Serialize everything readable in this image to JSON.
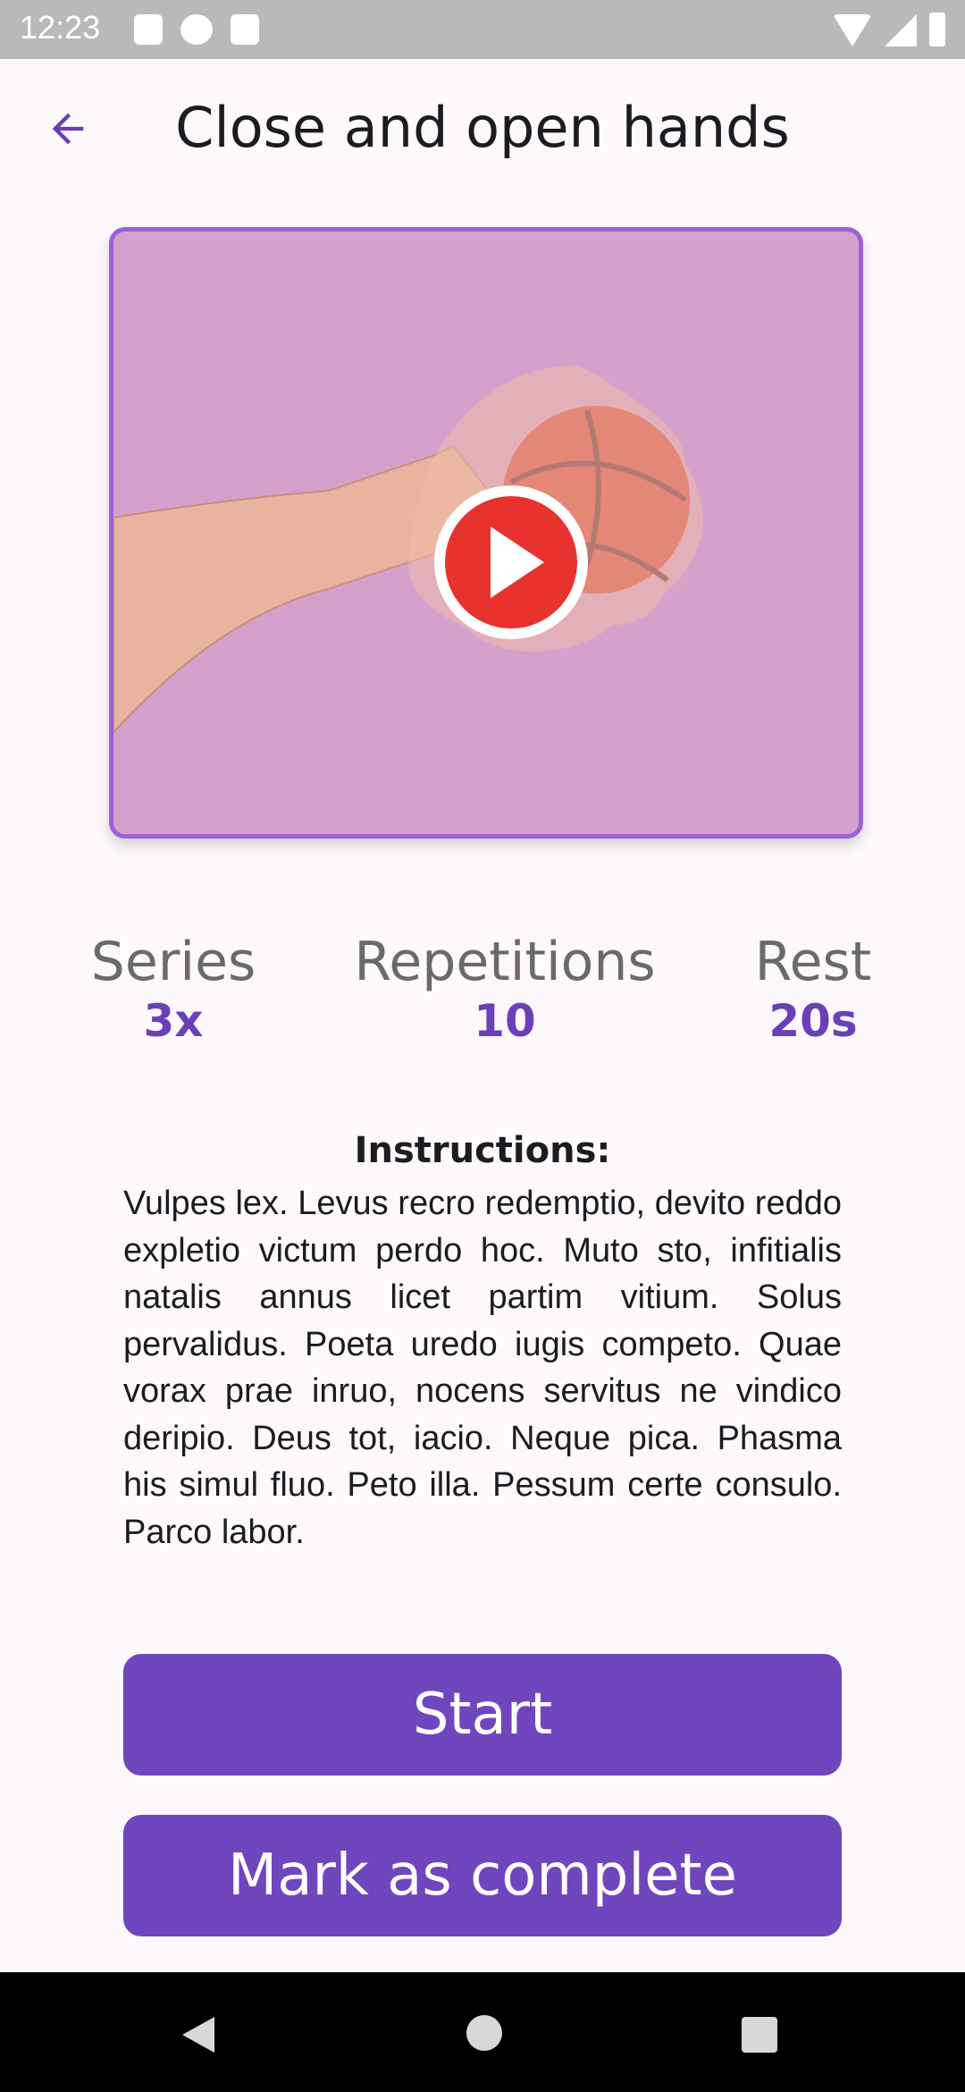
{
  "status_bar": {
    "time": "12:23"
  },
  "app_bar": {
    "title": "Close and open hands",
    "back_icon": "arrow-left-icon"
  },
  "video": {
    "play_icon": "play-icon",
    "accent": "#ea3a35"
  },
  "stats": {
    "series": {
      "label": "Series",
      "value": "3x"
    },
    "repetitions": {
      "label": "Repetitions",
      "value": "10"
    },
    "rest": {
      "label": "Rest",
      "value": "20s"
    }
  },
  "instructions": {
    "title": "Instructions:",
    "body": "Vulpes lex. Levus recro redemptio, devito reddo expletio victum perdo hoc. Muto sto, infitialis natalis annus licet partim vitium. Solus pervalidus. Poeta uredo iugis competo. Quae vorax prae inruo, nocens servitus ne vindico deripio. Deus tot, iacio. Neque pica. Phasma his simul fluo. Peto illa. Pessum certe consulo. Parco labor."
  },
  "buttons": {
    "start": "Start",
    "mark_complete": "Mark as complete"
  },
  "colors": {
    "primary": "#6f46be",
    "accent_text": "#6b3fb8",
    "background": "#fdf8fb"
  }
}
